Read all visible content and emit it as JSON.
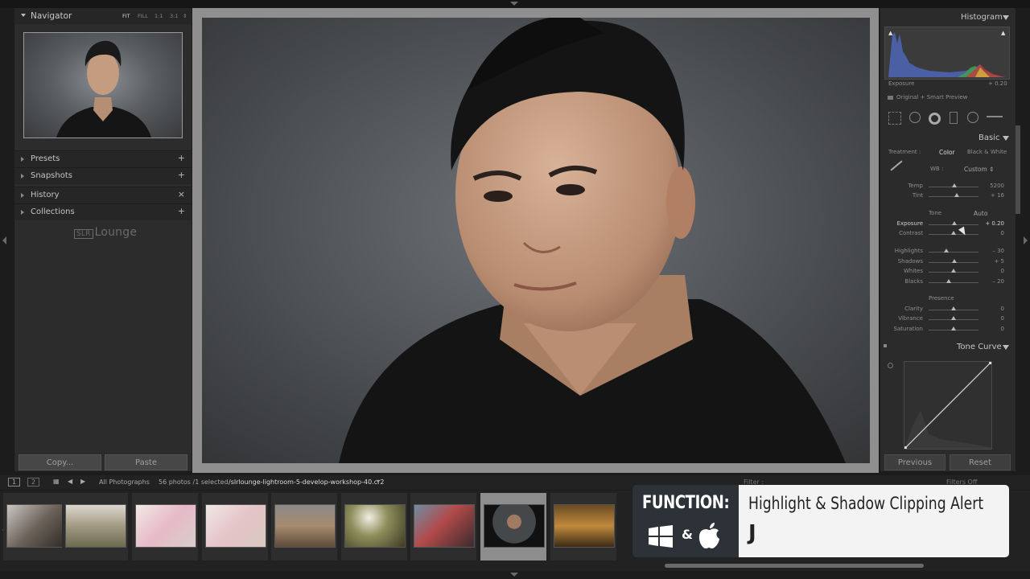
{
  "navigator": {
    "title": "Navigator",
    "zoom": [
      "FIT",
      "FILL",
      "1:1",
      "3:1"
    ]
  },
  "left_sections": [
    {
      "label": "Presets",
      "action": "+"
    },
    {
      "label": "Snapshots",
      "action": "+"
    },
    {
      "label": "History",
      "action": "×"
    },
    {
      "label": "Collections",
      "action": "+"
    }
  ],
  "logo": {
    "box": "SLR",
    "text": "Lounge"
  },
  "left_buttons": {
    "copy": "Copy...",
    "paste": "Paste"
  },
  "histogram": {
    "title": "Histogram",
    "exposure_label": "Exposure",
    "exposure_value": "+ 0.20",
    "preview_label": "Original + Smart Preview"
  },
  "basic": {
    "title": "Basic",
    "treatment_label": "Treatment :",
    "treatment_color": "Color",
    "treatment_bw": "Black & White",
    "wb_label": "WB :",
    "wb_value": "Custom",
    "temp": {
      "label": "Temp",
      "value": "5200",
      "level": 0.52
    },
    "tint": {
      "label": "Tint",
      "value": "+ 16",
      "level": 0.56
    },
    "tone_label": "Tone",
    "auto_label": "Auto",
    "exposure": {
      "label": "Exposure",
      "value": "+ 0.20",
      "level": 0.51
    },
    "contrast": {
      "label": "Contrast",
      "value": "0",
      "level": 0.5
    },
    "highlights": {
      "label": "Highlights",
      "value": "– 30",
      "level": 0.35
    },
    "shadows": {
      "label": "Shadows",
      "value": "+ 5",
      "level": 0.52
    },
    "whites": {
      "label": "Whites",
      "value": "0",
      "level": 0.5
    },
    "blacks": {
      "label": "Blacks",
      "value": "– 20",
      "level": 0.4
    },
    "presence_label": "Presence",
    "clarity": {
      "label": "Clarity",
      "value": "0",
      "level": 0.5
    },
    "vibrance": {
      "label": "Vibrance",
      "value": "0",
      "level": 0.5
    },
    "saturation": {
      "label": "Saturation",
      "value": "0",
      "level": 0.5
    }
  },
  "tone_curve": {
    "title": "Tone Curve"
  },
  "right_buttons": {
    "previous": "Previous",
    "reset": "Reset"
  },
  "filmstrip_bar": {
    "screen1": "1",
    "screen2": "2",
    "source": "All Photographs",
    "count": "56 photos /1 selected",
    "filename": "/slrlounge-lightroom-5-develop-workshop-40.cr2",
    "filter_label": "Filter :",
    "filter_value": "Filters Off"
  },
  "overlay": {
    "function_label": "FUNCTION:",
    "amp": "&",
    "title": "Highlight & Shadow Clipping Alert",
    "key": "J"
  },
  "colors": {
    "panel": "#2c2c2c",
    "background": "#4a4d50",
    "overlay_dark": "#2d3238",
    "overlay_light": "#f3f3f3"
  }
}
